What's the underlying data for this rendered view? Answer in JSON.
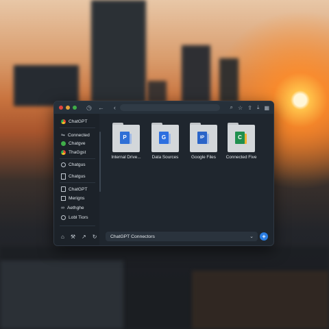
{
  "window": {
    "title_controls": [
      "close",
      "minimize",
      "maximize"
    ],
    "colors": {
      "close": "#e0443e",
      "minimize": "#e2a33a",
      "maximize": "#3fae49"
    }
  },
  "sidebar": {
    "items": [
      {
        "label": "ChatGPT",
        "icon": "chrome-icon"
      },
      {
        "label": "Connected",
        "icon": "connect-icon"
      },
      {
        "label": "Chatgve",
        "icon": "check-circle-icon"
      },
      {
        "label": "ThaGgst",
        "icon": "chrome-icon"
      },
      {
        "label": "Chatgus",
        "icon": "chat-bubble-icon"
      },
      {
        "label": "Chatgus",
        "icon": "document-icon"
      },
      {
        "label": "ChatGPT",
        "icon": "copy-icon"
      },
      {
        "label": "Merigns",
        "icon": "image-icon"
      },
      {
        "label": "Aethghe",
        "icon": "link-icon"
      },
      {
        "label": "Lobl Tiors",
        "icon": "circle-check-icon"
      }
    ],
    "bottom_icons": [
      "home-icon",
      "tools-icon",
      "pin-icon",
      "refresh-icon"
    ]
  },
  "folders": [
    {
      "label": "Internal Drive...",
      "badge": "P",
      "color": "#2f6fd6"
    },
    {
      "label": "Data Sources",
      "badge": "G",
      "color": "#2d6fe0"
    },
    {
      "label": "Google Files",
      "badge": "IP",
      "color": "#2a64c8"
    },
    {
      "label": "Connected Five",
      "badge": "C",
      "color": "#1f8f4e"
    }
  ],
  "bottombar": {
    "text": "ChatGPT Connectors",
    "send_label": "+"
  }
}
